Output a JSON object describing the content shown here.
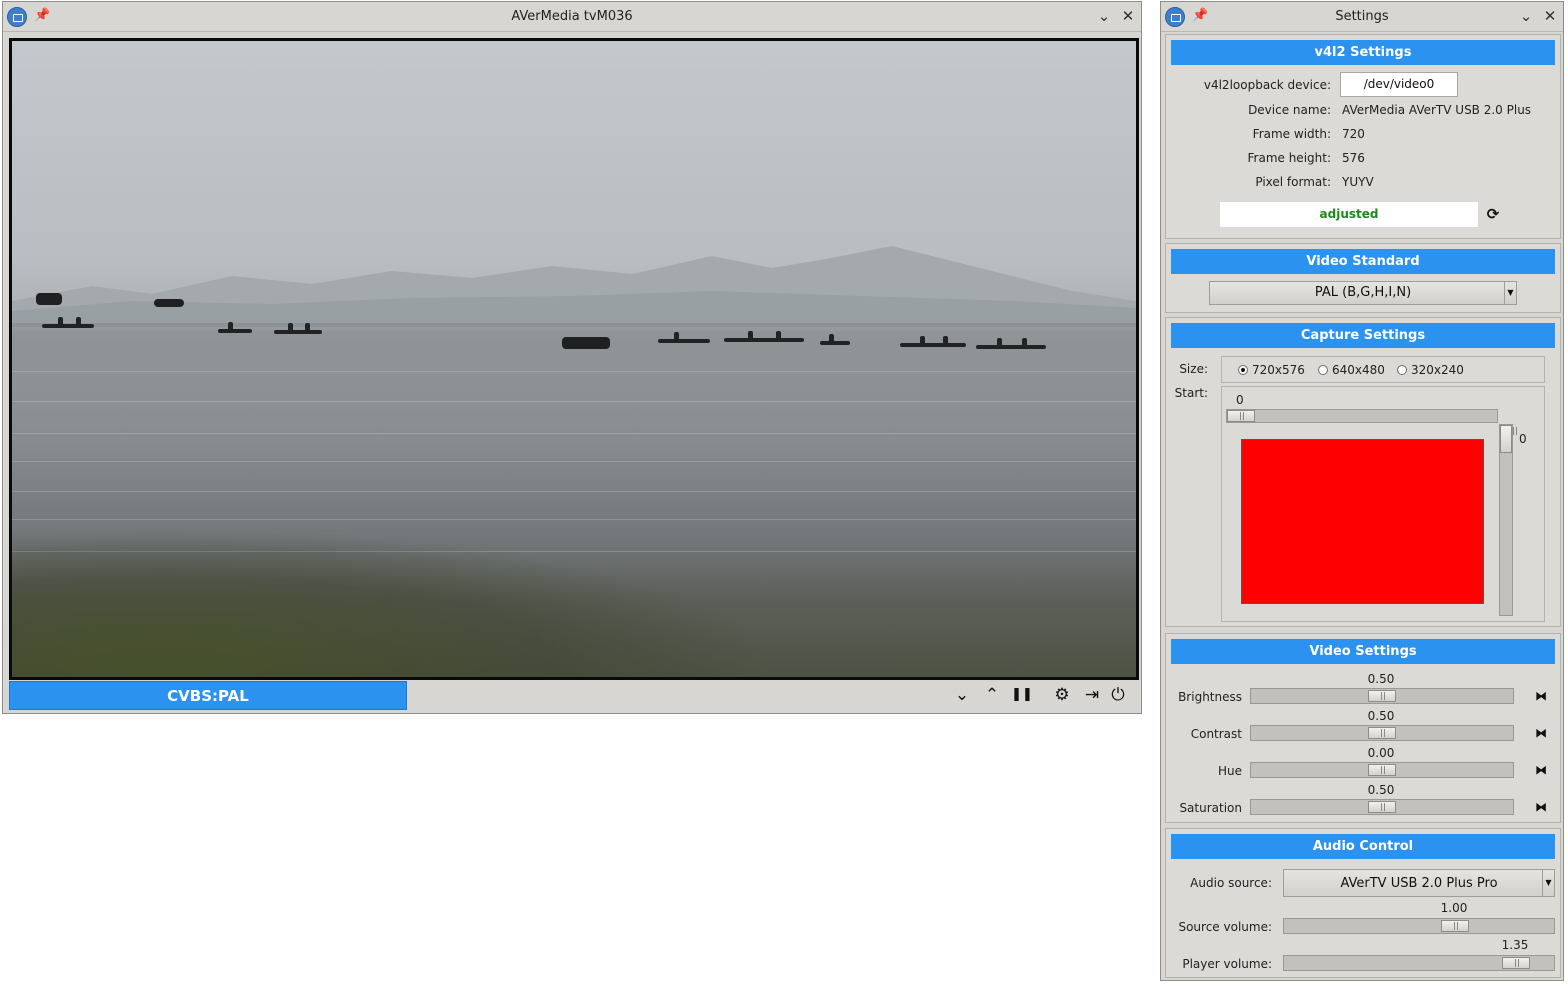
{
  "main_window": {
    "title": "AVerMedia tvM036",
    "channel_label": "CVBS:PAL",
    "icons": {
      "app": "camera-icon",
      "pin": "pin-icon",
      "minimize": "chevron-down-icon",
      "close": "close-icon",
      "down": "chevron-down-icon",
      "up": "chevron-up-icon",
      "pause": "pause-icon",
      "settings": "gear-icon",
      "exit": "exit-icon",
      "power": "power-icon"
    },
    "glyphs": {
      "pin": "📌",
      "minimize": "⌄",
      "close": "✕",
      "down": "⌄",
      "up": "⌃",
      "pause": "❚❚",
      "settings": "⚙",
      "exit": "⇥",
      "power": "⏻"
    }
  },
  "settings_window": {
    "title": "Settings",
    "v4l2": {
      "header": "v4l2 Settings",
      "loopback_label": "v4l2loopback device:",
      "loopback_value": "/dev/video0",
      "device_name_label": "Device name:",
      "device_name_value": "AVerMedia AVerTV USB 2.0 Plus",
      "frame_width_label": "Frame width:",
      "frame_width_value": "720",
      "frame_height_label": "Frame height:",
      "frame_height_value": "576",
      "pixel_format_label": "Pixel format:",
      "pixel_format_value": "YUYV",
      "status_value": "adjusted",
      "status_color": "#1a8a1a",
      "refresh_glyph": "⟳"
    },
    "video_standard": {
      "header": "Video Standard",
      "selected": "PAL (B,G,H,I,N)"
    },
    "capture": {
      "header": "Capture Settings",
      "size_label": "Size:",
      "sizes": [
        "720x576",
        "640x480",
        "320x240"
      ],
      "selected_size": "720x576",
      "start_label": "Start:",
      "start_x_value": "0",
      "start_y_value": "0",
      "preview_color": "#ff0000"
    },
    "video_settings": {
      "header": "Video Settings",
      "sliders": [
        {
          "label": "Brightness",
          "value": "0.50",
          "fraction": 0.5
        },
        {
          "label": "Contrast",
          "value": "0.50",
          "fraction": 0.5
        },
        {
          "label": "Hue",
          "value": "0.00",
          "fraction": 0.5
        },
        {
          "label": "Saturation",
          "value": "0.50",
          "fraction": 0.5
        }
      ],
      "reset_glyph": "⧓"
    },
    "audio": {
      "header": "Audio Control",
      "source_label": "Audio source:",
      "source_value": "AVerTV USB 2.0 Plus Pro",
      "source_volume_label": "Source volume:",
      "source_volume_value": "1.00",
      "source_volume_fraction": 0.65,
      "player_volume_label": "Player volume:",
      "player_volume_value": "1.35",
      "player_volume_fraction": 0.9
    }
  },
  "accent_color": "#2b92ef"
}
